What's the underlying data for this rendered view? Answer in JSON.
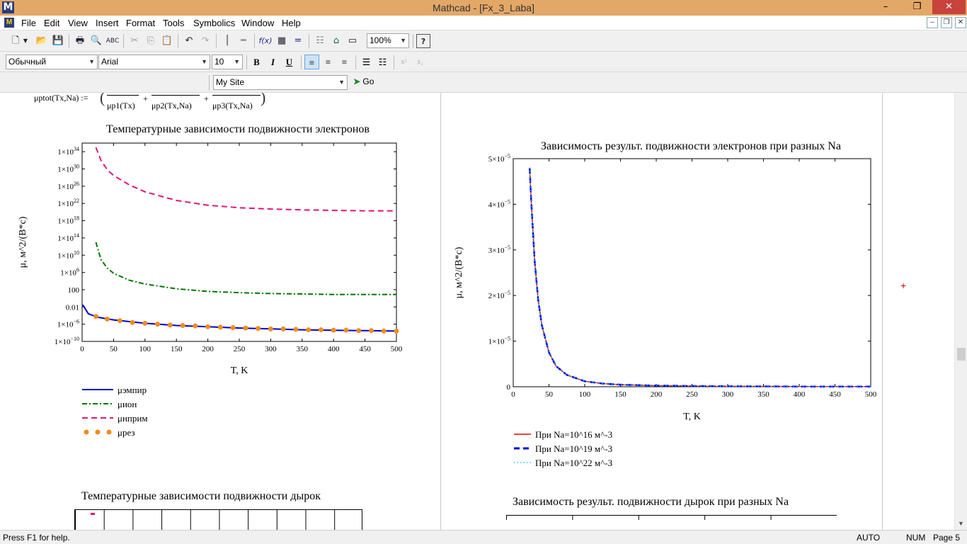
{
  "window": {
    "title": "Mathcad - [Fx_3_Laba]",
    "app_icon": "M",
    "minimize": "–",
    "restore": "❐",
    "close": "✕"
  },
  "menu": {
    "items": [
      "File",
      "Edit",
      "View",
      "Insert",
      "Format",
      "Tools",
      "Symbolics",
      "Window",
      "Help"
    ],
    "doc_controls": [
      "–",
      "❐",
      "✕"
    ]
  },
  "toolbar": {
    "zoom": "100%",
    "style": "Обычный",
    "font": "Arial",
    "size": "10",
    "bold": "B",
    "italic": "I",
    "underline": "U",
    "site": "My Site",
    "go": "Go"
  },
  "formula": {
    "lhs": "μptot(Tx,Na) :=",
    "terms": [
      "μp1(Tx)",
      "μp2(Tx,Na)",
      "μp3(Tx,Na)"
    ],
    "plus": "+"
  },
  "chart_data": [
    {
      "type": "line",
      "title": "Температурные зависимости подвижности электронов",
      "xlabel": "T, K",
      "ylabel": "μ, м^2/(В*с)",
      "yscale": "log",
      "xlim": [
        0,
        500
      ],
      "ylim_exp": [
        -10,
        36
      ],
      "xticks": [
        "0",
        "50",
        "100",
        "150",
        "200",
        "250",
        "300",
        "350",
        "400",
        "450",
        "500"
      ],
      "yticks": [
        {
          "exp": 34,
          "label": "1×10",
          "sup": "34"
        },
        {
          "exp": 30,
          "label": "1×10",
          "sup": "30"
        },
        {
          "exp": 26,
          "label": "1×10",
          "sup": "26"
        },
        {
          "exp": 22,
          "label": "1×10",
          "sup": "22"
        },
        {
          "exp": 18,
          "label": "1×10",
          "sup": "18"
        },
        {
          "exp": 14,
          "label": "1×10",
          "sup": "14"
        },
        {
          "exp": 10,
          "label": "1×10",
          "sup": "10"
        },
        {
          "exp": 6,
          "label": "1×10",
          "sup": "6"
        },
        {
          "exp": 2,
          "label": "100",
          "sup": ""
        },
        {
          "exp": -2,
          "label": "0.01",
          "sup": ""
        },
        {
          "exp": -6,
          "label": "1×10",
          "sup": "−6"
        },
        {
          "exp": -10,
          "label": "1×10",
          "sup": "−10"
        }
      ],
      "series": [
        {
          "name": "μэмпир",
          "color": "#0000cc",
          "style": "solid",
          "x": [
            1,
            10,
            25,
            50,
            100,
            150,
            200,
            250,
            300,
            350,
            400,
            450,
            500
          ],
          "y_exp": [
            -1.5,
            -3.6,
            -4.4,
            -5.0,
            -5.8,
            -6.3,
            -6.6,
            -6.9,
            -7.1,
            -7.3,
            -7.4,
            -7.5,
            -7.6
          ]
        },
        {
          "name": "μион",
          "color": "#007700",
          "style": "dashdot",
          "x": [
            22,
            30,
            40,
            50,
            75,
            100,
            150,
            200,
            250,
            300,
            350,
            400,
            450,
            500
          ],
          "y_exp": [
            13.0,
            9.0,
            7.0,
            5.8,
            4.2,
            3.3,
            2.2,
            1.6,
            1.3,
            1.1,
            1.0,
            0.9,
            0.9,
            0.9
          ]
        },
        {
          "name": "μнприм",
          "color": "#e0147c",
          "style": "dashed",
          "x": [
            22,
            30,
            40,
            50,
            75,
            100,
            150,
            200,
            250,
            300,
            350,
            400,
            450,
            500
          ],
          "y_exp": [
            35.0,
            32.0,
            29.8,
            28.5,
            26.3,
            24.7,
            22.7,
            21.6,
            21.0,
            20.7,
            20.5,
            20.4,
            20.3,
            20.3
          ]
        },
        {
          "name": "μрез",
          "color": "#f28c1c",
          "style": "dots",
          "x": [
            22,
            40,
            60,
            80,
            100,
            120,
            140,
            160,
            180,
            200,
            220,
            240,
            260,
            280,
            300,
            320,
            340,
            360,
            380,
            400,
            420,
            440,
            460,
            480,
            500
          ],
          "y_exp": [
            -4.2,
            -4.8,
            -5.2,
            -5.6,
            -5.8,
            -6.0,
            -6.2,
            -6.3,
            -6.4,
            -6.6,
            -6.7,
            -6.8,
            -6.9,
            -7.0,
            -7.1,
            -7.1,
            -7.2,
            -7.3,
            -7.3,
            -7.4,
            -7.4,
            -7.5,
            -7.5,
            -7.6,
            -7.6
          ]
        }
      ]
    },
    {
      "type": "line",
      "title": "Зависимость результ. подвижности электронов при разных Na",
      "xlabel": "T, K",
      "ylabel": "μ, м^2/(В*с)",
      "xlim": [
        0,
        500
      ],
      "ylim": [
        0,
        5e-05
      ],
      "xticks": [
        "0",
        "50",
        "100",
        "150",
        "200",
        "250",
        "300",
        "350",
        "400",
        "450",
        "500"
      ],
      "yticks": [
        {
          "value": 5e-05,
          "label": "5×10",
          "sup": "−5"
        },
        {
          "value": 4e-05,
          "label": "4×10",
          "sup": "−5"
        },
        {
          "value": 3e-05,
          "label": "3×10",
          "sup": "−5"
        },
        {
          "value": 2e-05,
          "label": "2×10",
          "sup": "−5"
        },
        {
          "value": 1e-05,
          "label": "1×10",
          "sup": "−5"
        },
        {
          "value": 0,
          "label": "0",
          "sup": ""
        }
      ],
      "series": [
        {
          "name": "При Na=10^16 м^-3",
          "color": "#ee0000",
          "style": "solid",
          "x": [
            23,
            25,
            30,
            35,
            40,
            50,
            60,
            75,
            100,
            125,
            150,
            200,
            250,
            300,
            350,
            400,
            450,
            500
          ],
          "y": [
            4.8e-05,
            4.1e-05,
            2.75e-05,
            1.9e-05,
            1.35e-05,
            7.5e-06,
            4.5e-06,
            2.6e-06,
            1.2e-06,
            7e-07,
            4.5e-07,
            2.5e-07,
            1.5e-07,
            1e-07,
            7e-08,
            5e-08,
            4e-08,
            3e-08
          ]
        },
        {
          "name": "При Na=10^19 м^-3",
          "color": "#0000dd",
          "style": "dashed",
          "x": [
            23,
            25,
            30,
            35,
            40,
            50,
            60,
            75,
            100,
            125,
            150,
            200,
            250,
            300,
            350,
            400,
            450,
            500
          ],
          "y": [
            4.8e-05,
            4.1e-05,
            2.75e-05,
            1.9e-05,
            1.35e-05,
            7.5e-06,
            4.5e-06,
            2.6e-06,
            1.2e-06,
            7e-07,
            4.5e-07,
            2.5e-07,
            1.5e-07,
            1e-07,
            7e-08,
            5e-08,
            4e-08,
            3e-08
          ]
        },
        {
          "name": "При Na=10^22 м^-3",
          "color": "#22ccee",
          "style": "dotted",
          "x": [
            23,
            25,
            30,
            35,
            40,
            50,
            60,
            75,
            100,
            125,
            150,
            200,
            250,
            300,
            350,
            400,
            450,
            500
          ],
          "y": [
            4.8e-05,
            4.1e-05,
            2.75e-05,
            1.9e-05,
            1.35e-05,
            7.5e-06,
            4.5e-06,
            2.6e-06,
            1.2e-06,
            7e-07,
            4.5e-07,
            2.5e-07,
            1.5e-07,
            1e-07,
            7e-08,
            5e-08,
            4e-08,
            3e-08
          ]
        }
      ]
    }
  ],
  "lower_titles": {
    "left": "Температурные зависимости подвижности дырок",
    "right": "Зависимость результ. подвижности дырок при разных Na"
  },
  "cursor": "+",
  "status": {
    "help": "Press F1 for help.",
    "mode": "AUTO",
    "num": "NUM",
    "page": "Page 5"
  }
}
